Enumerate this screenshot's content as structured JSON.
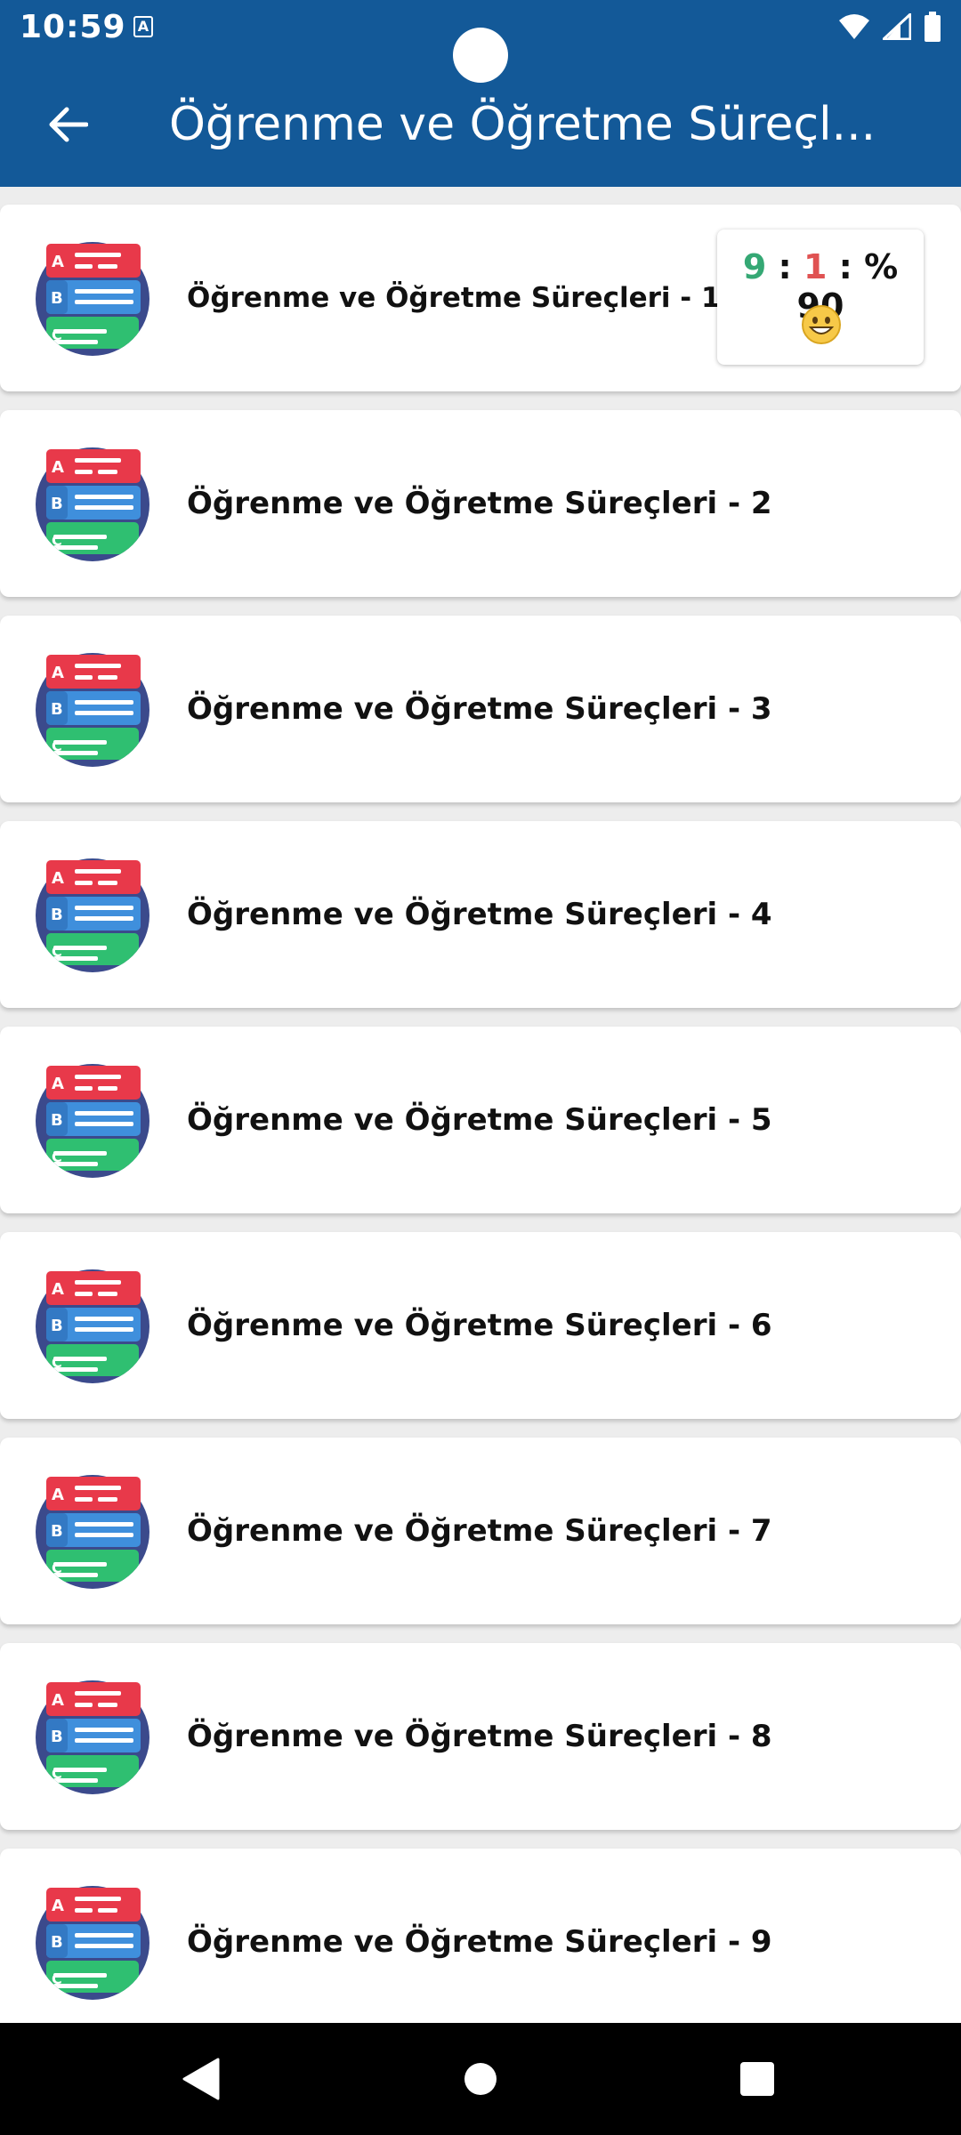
{
  "status_bar": {
    "time": "10:59",
    "notification_icon_letter": "A",
    "icons": [
      "wifi-icon",
      "signal-icon",
      "battery-icon"
    ]
  },
  "app_bar": {
    "title": "Öğrenme ve Öğretme Süreçl...",
    "back_icon": "arrow-left-icon",
    "background_color": "#135998"
  },
  "tests": [
    {
      "label": "Öğrenme ve Öğretme Süreçleri - 1",
      "score": {
        "correct": "9",
        "wrong": "1",
        "sep": ":",
        "percent": "% 90",
        "emoji": "grinning-face"
      }
    },
    {
      "label": "Öğrenme ve Öğretme Süreçleri - 2"
    },
    {
      "label": "Öğrenme ve Öğretme Süreçleri - 3"
    },
    {
      "label": "Öğrenme ve Öğretme Süreçleri - 4"
    },
    {
      "label": "Öğrenme ve Öğretme Süreçleri - 5"
    },
    {
      "label": "Öğrenme ve Öğretme Süreçleri - 6"
    },
    {
      "label": "Öğrenme ve Öğretme Süreçleri - 7"
    },
    {
      "label": "Öğrenme ve Öğretme Süreçleri - 8"
    },
    {
      "label": "Öğrenme ve Öğretme Süreçleri - 9"
    }
  ],
  "colors": {
    "correct": "#35a874",
    "wrong": "#e05252",
    "icon_circle": "#3b4a8c",
    "option_a": "#e8394a",
    "option_b": "#3f8fdc",
    "option_c": "#2fbf71"
  },
  "nav_bar": {
    "buttons": [
      "back-triangle-icon",
      "home-circle-icon",
      "recents-square-icon"
    ]
  }
}
